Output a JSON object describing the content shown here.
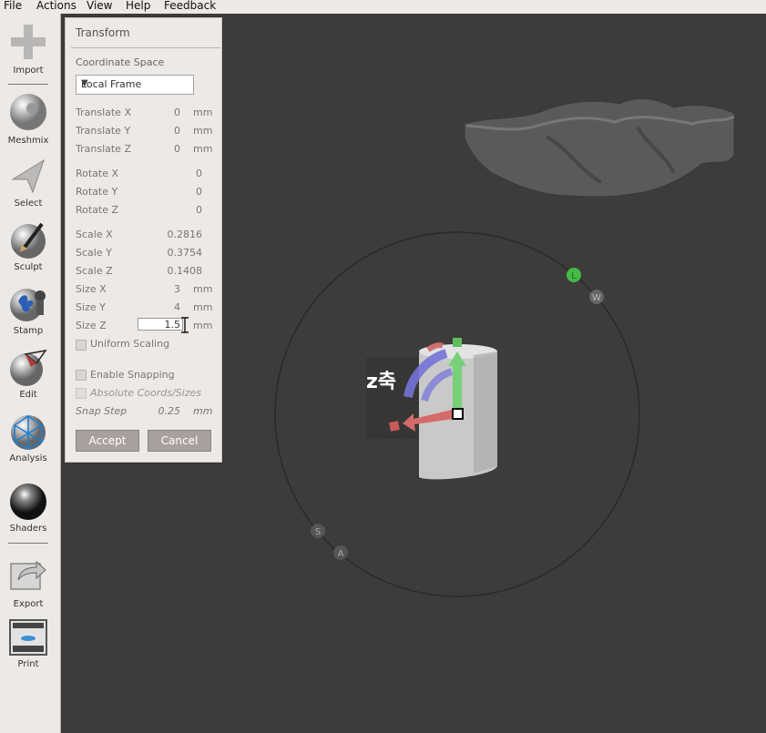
{
  "menu": [
    "File",
    "Actions",
    "View",
    "Help",
    "Feedback"
  ],
  "toolbar": {
    "import": "Import",
    "meshmix": "Meshmix",
    "select": "Select",
    "sculpt": "Sculpt",
    "stamp": "Stamp",
    "edit": "Edit",
    "analysis": "Analysis",
    "shaders": "Shaders",
    "export": "Export",
    "print": "Print"
  },
  "transform": {
    "title": "Transform",
    "coord_label": "Coordinate Space",
    "coord_value": "Local Frame",
    "translate_x": {
      "label": "Translate X",
      "value": "0",
      "unit": "mm"
    },
    "translate_y": {
      "label": "Translate Y",
      "value": "0",
      "unit": "mm"
    },
    "translate_z": {
      "label": "Translate Z",
      "value": "0",
      "unit": "mm"
    },
    "rotate_x": {
      "label": "Rotate X",
      "value": "0"
    },
    "rotate_y": {
      "label": "Rotate Y",
      "value": "0"
    },
    "rotate_z": {
      "label": "Rotate Z",
      "value": "0"
    },
    "scale_x": {
      "label": "Scale X",
      "value": "0.2816"
    },
    "scale_y": {
      "label": "Scale Y",
      "value": "0.3754"
    },
    "scale_z": {
      "label": "Scale Z",
      "value": "0.1408"
    },
    "size_x": {
      "label": "Size X",
      "value": "3",
      "unit": "mm"
    },
    "size_y": {
      "label": "Size Y",
      "value": "4",
      "unit": "mm"
    },
    "size_z": {
      "label": "Size Z",
      "value": "1.5",
      "unit": "mm"
    },
    "uniform_scaling": "Uniform Scaling",
    "enable_snapping": "Enable Snapping",
    "absolute_coords": "Absolute Coords/Sizes",
    "snap_step": {
      "label": "Snap Step",
      "value": "0.25",
      "unit": "mm"
    },
    "accept": "Accept",
    "cancel": "Cancel"
  },
  "viewport": {
    "annotation": "z축",
    "gizmo_labels": {
      "l": "L",
      "w": "W",
      "s": "S",
      "a": "A"
    }
  },
  "colors": {
    "x_axis": "#d46a6a",
    "y_axis": "#6fcf6f",
    "z_axis": "#7a7ad8",
    "panel_bg": "#ece9e6",
    "viewport_bg": "#3d3c3a"
  }
}
